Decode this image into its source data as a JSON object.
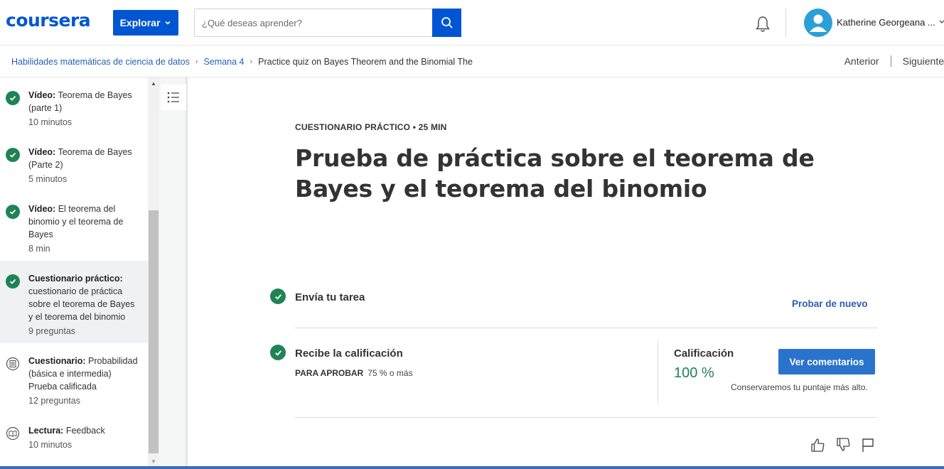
{
  "header": {
    "logo": "coursera",
    "explore_label": "Explorar",
    "search_placeholder": "¿Qué deseas aprender?",
    "user_name": "Katherine Georgeana ..."
  },
  "breadcrumb": {
    "items": [
      "Habilidades matemáticas de ciencia de datos",
      "Semana 4"
    ],
    "current": "Practice quiz on Bayes Theorem and the Binomial The",
    "prev_label": "Anterior",
    "next_label": "Siguiente"
  },
  "sidebar": {
    "items": [
      {
        "type": "Vídeo:",
        "title": "Teorema de Bayes (parte 1)",
        "meta": "10 minutos",
        "status": "completed"
      },
      {
        "type": "Vídeo:",
        "title": "Teorema de Bayes (Parte 2)",
        "meta": "5 minutos",
        "status": "completed"
      },
      {
        "type": "Vídeo:",
        "title": "El teorema del binomio y el teorema de Bayes",
        "meta": "8 min",
        "status": "completed"
      },
      {
        "type": "Cuestionario práctico:",
        "title": "cuestionario de práctica sobre el teorema de Bayes y el teorema del binomio",
        "meta": "9 preguntas",
        "status": "completed"
      },
      {
        "type": "Cuestionario:",
        "title": "Probabilidad (básica e intermedia) Prueba calificada",
        "meta": "12 preguntas",
        "status": "quiz"
      },
      {
        "type": "Lectura:",
        "title": "Feedback",
        "meta": "10 minutos",
        "status": "reading"
      }
    ]
  },
  "main": {
    "kicker": "CUESTIONARIO PRÁCTICO • 25 MIN",
    "title": "Prueba de práctica sobre el teorema de Bayes y el teorema del binomio",
    "step1_label": "Envía tu tarea",
    "retry_label": "Probar de nuevo",
    "step2_label": "Recibe la calificación",
    "pass_label": "PARA APROBAR",
    "pass_value": "75 % o más",
    "grade_label": "Calificación",
    "grade_value": "100 %",
    "feedback_button": "Ver comentarios",
    "keep_note": "Conservaremos tu puntaje más alto."
  },
  "colors": {
    "brand": "#0056d2",
    "success": "#1f8354",
    "link": "#2a5fb0"
  }
}
